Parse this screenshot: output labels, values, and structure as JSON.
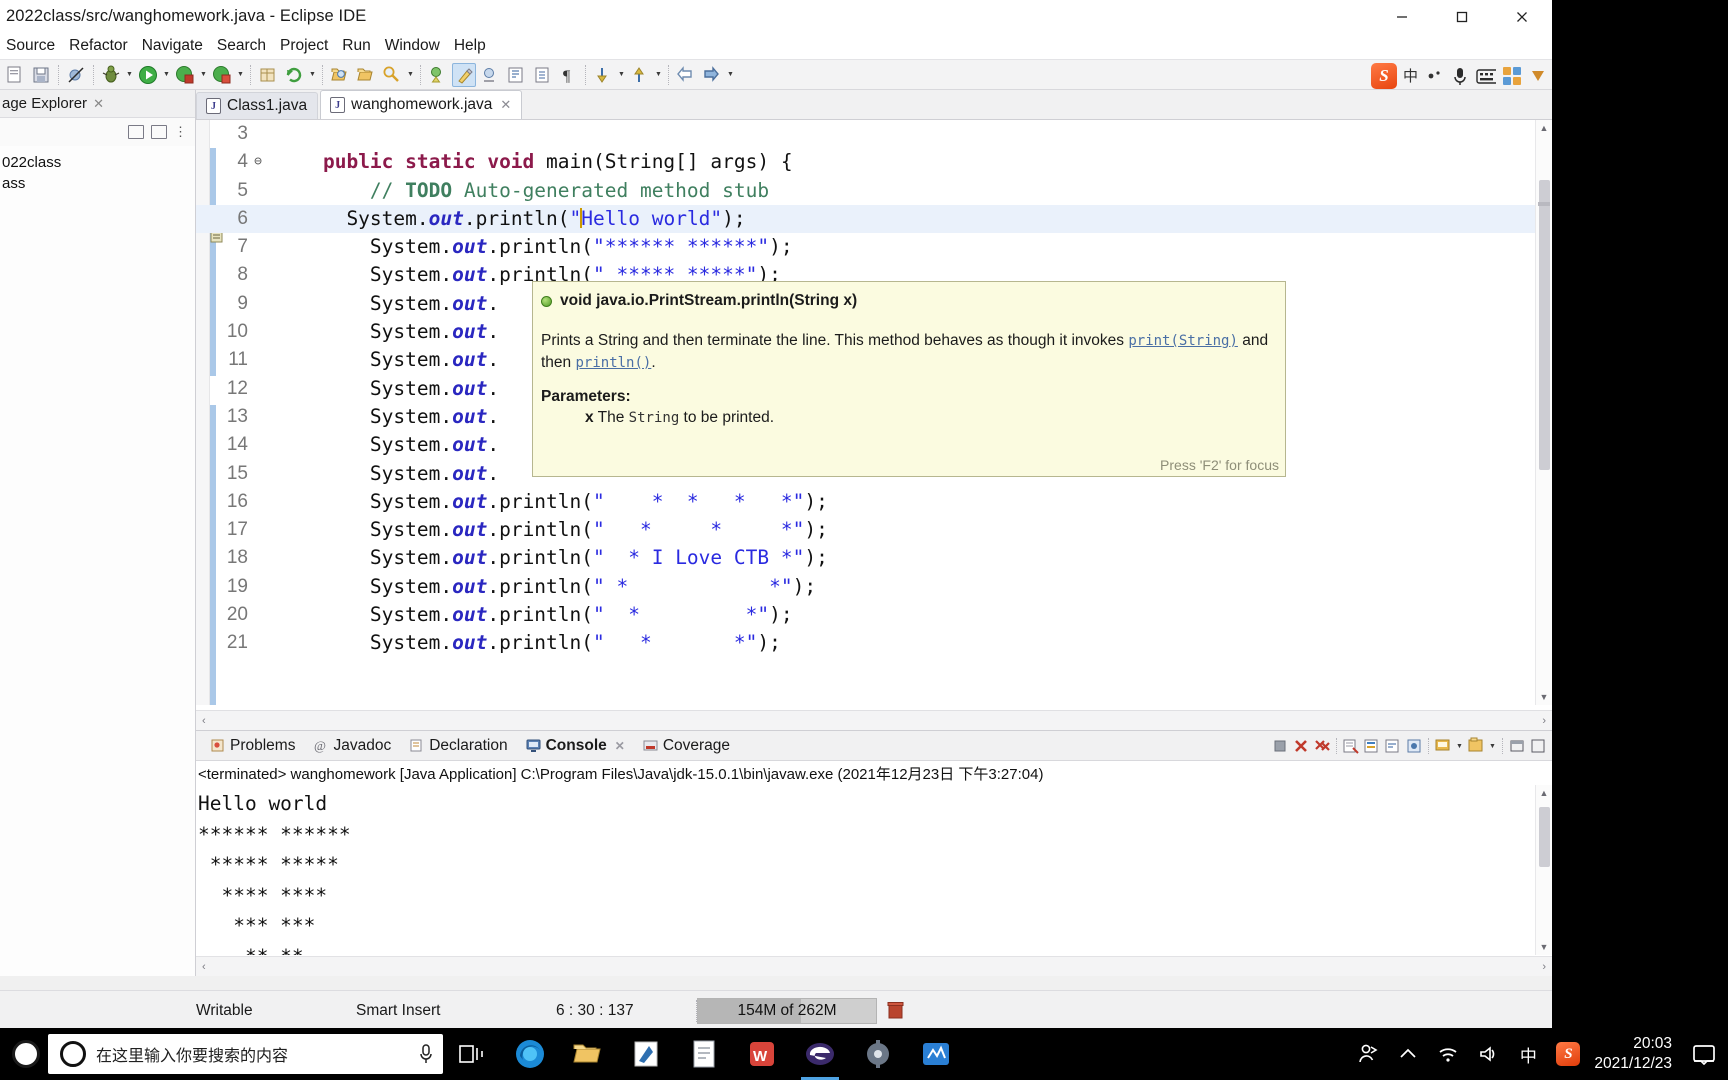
{
  "window": {
    "title": "2022class/src/wanghomework.java - Eclipse IDE",
    "minimize_label": "Minimize",
    "maximize_label": "Maximize",
    "close_label": "Close"
  },
  "menubar": {
    "items": [
      {
        "label": "Source"
      },
      {
        "label": "Refactor"
      },
      {
        "label": "Navigate"
      },
      {
        "label": "Search"
      },
      {
        "label": "Project"
      },
      {
        "label": "Run"
      },
      {
        "label": "Window"
      },
      {
        "label": "Help"
      }
    ]
  },
  "toolbar": {
    "ime_lang": "中",
    "sogou_label": "S"
  },
  "explorer": {
    "tab_label": "age Explorer",
    "tree": [
      {
        "label": "022class"
      },
      {
        "label": "ass"
      }
    ]
  },
  "editor": {
    "tabs": [
      {
        "label": "Class1.java",
        "active": false,
        "closable": false
      },
      {
        "label": "wanghomework.java",
        "active": true,
        "closable": true
      }
    ],
    "lines": [
      {
        "num": "3",
        "fold": "",
        "current": false,
        "tokens": []
      },
      {
        "num": "4",
        "fold": "⊖",
        "current": false,
        "tokens": [
          {
            "t": "    ",
            "c": "pln"
          },
          {
            "t": "public static void ",
            "c": "kw"
          },
          {
            "t": "main(String[] args) {",
            "c": "pln"
          }
        ]
      },
      {
        "num": "5",
        "fold": "",
        "current": false,
        "tokens": [
          {
            "t": "        ",
            "c": "pln"
          },
          {
            "t": "// ",
            "c": "cmt"
          },
          {
            "t": "TODO",
            "c": "cmtb"
          },
          {
            "t": " Auto-generated method stub",
            "c": "cmt"
          }
        ]
      },
      {
        "num": "6",
        "fold": "",
        "current": true,
        "tokens": [
          {
            "t": "      System.",
            "c": "pln"
          },
          {
            "t": "out",
            "c": "fld"
          },
          {
            "t": ".println(",
            "c": "pln"
          },
          {
            "t": "\"",
            "c": "str"
          },
          {
            "t": "|CARET|",
            "c": "caret"
          },
          {
            "t": "Hello world\"",
            "c": "str"
          },
          {
            "t": ");",
            "c": "pln"
          }
        ]
      },
      {
        "num": "7",
        "fold": "",
        "current": false,
        "tokens": [
          {
            "t": "        System.",
            "c": "pln"
          },
          {
            "t": "out",
            "c": "fld"
          },
          {
            "t": ".println(",
            "c": "pln"
          },
          {
            "t": "\"****** ******\"",
            "c": "str"
          },
          {
            "t": ");",
            "c": "pln"
          }
        ]
      },
      {
        "num": "8",
        "fold": "",
        "current": false,
        "tokens": [
          {
            "t": "        System.",
            "c": "pln"
          },
          {
            "t": "out",
            "c": "fld"
          },
          {
            "t": ".println(",
            "c": "pln"
          },
          {
            "t": "\" ***** *****\"",
            "c": "str"
          },
          {
            "t": ");",
            "c": "pln"
          }
        ]
      },
      {
        "num": "9",
        "fold": "",
        "current": false,
        "tokens": [
          {
            "t": "        System.",
            "c": "pln"
          },
          {
            "t": "out",
            "c": "fld"
          },
          {
            "t": ".",
            "c": "pln"
          }
        ]
      },
      {
        "num": "10",
        "fold": "",
        "current": false,
        "tokens": [
          {
            "t": "        System.",
            "c": "pln"
          },
          {
            "t": "out",
            "c": "fld"
          },
          {
            "t": ".",
            "c": "pln"
          }
        ]
      },
      {
        "num": "11",
        "fold": "",
        "current": false,
        "tokens": [
          {
            "t": "        System.",
            "c": "pln"
          },
          {
            "t": "out",
            "c": "fld"
          },
          {
            "t": ".",
            "c": "pln"
          }
        ]
      },
      {
        "num": "12",
        "fold": "",
        "current": false,
        "tokens": [
          {
            "t": "        System.",
            "c": "pln"
          },
          {
            "t": "out",
            "c": "fld"
          },
          {
            "t": ".",
            "c": "pln"
          }
        ]
      },
      {
        "num": "13",
        "fold": "",
        "current": false,
        "tokens": [
          {
            "t": "        System.",
            "c": "pln"
          },
          {
            "t": "out",
            "c": "fld"
          },
          {
            "t": ".",
            "c": "pln"
          }
        ]
      },
      {
        "num": "14",
        "fold": "",
        "current": false,
        "tokens": [
          {
            "t": "        System.",
            "c": "pln"
          },
          {
            "t": "out",
            "c": "fld"
          },
          {
            "t": ".",
            "c": "pln"
          }
        ]
      },
      {
        "num": "15",
        "fold": "",
        "current": false,
        "tokens": [
          {
            "t": "        System.",
            "c": "pln"
          },
          {
            "t": "out",
            "c": "fld"
          },
          {
            "t": ".",
            "c": "pln"
          }
        ]
      },
      {
        "num": "16",
        "fold": "",
        "current": false,
        "tokens": [
          {
            "t": "        System.",
            "c": "pln"
          },
          {
            "t": "out",
            "c": "fld"
          },
          {
            "t": ".println(",
            "c": "pln"
          },
          {
            "t": "\"    *  *   *   *\"",
            "c": "str"
          },
          {
            "t": ");",
            "c": "pln"
          }
        ]
      },
      {
        "num": "17",
        "fold": "",
        "current": false,
        "tokens": [
          {
            "t": "        System.",
            "c": "pln"
          },
          {
            "t": "out",
            "c": "fld"
          },
          {
            "t": ".println(",
            "c": "pln"
          },
          {
            "t": "\"   *     *     *\"",
            "c": "str"
          },
          {
            "t": ");",
            "c": "pln"
          }
        ]
      },
      {
        "num": "18",
        "fold": "",
        "current": false,
        "tokens": [
          {
            "t": "        System.",
            "c": "pln"
          },
          {
            "t": "out",
            "c": "fld"
          },
          {
            "t": ".println(",
            "c": "pln"
          },
          {
            "t": "\"  * I Love CTB *\"",
            "c": "str"
          },
          {
            "t": ");",
            "c": "pln"
          }
        ]
      },
      {
        "num": "19",
        "fold": "",
        "current": false,
        "tokens": [
          {
            "t": "        System.",
            "c": "pln"
          },
          {
            "t": "out",
            "c": "fld"
          },
          {
            "t": ".println(",
            "c": "pln"
          },
          {
            "t": "\" *            *\"",
            "c": "str"
          },
          {
            "t": ");",
            "c": "pln"
          }
        ]
      },
      {
        "num": "20",
        "fold": "",
        "current": false,
        "tokens": [
          {
            "t": "        System.",
            "c": "pln"
          },
          {
            "t": "out",
            "c": "fld"
          },
          {
            "t": ".println(",
            "c": "pln"
          },
          {
            "t": "\"  *         *\"",
            "c": "str"
          },
          {
            "t": ");",
            "c": "pln"
          }
        ]
      },
      {
        "num": "21",
        "fold": "",
        "current": false,
        "tokens": [
          {
            "t": "        System.",
            "c": "pln"
          },
          {
            "t": "out",
            "c": "fld"
          },
          {
            "t": ".println(",
            "c": "pln"
          },
          {
            "t": "\"   *       *\"",
            "c": "str"
          },
          {
            "t": ");",
            "c": "pln"
          }
        ]
      }
    ]
  },
  "tooltip": {
    "signature": "void java.io.PrintStream.println(String x)",
    "body_pre": "Prints a String and then terminate the line. This method behaves as though it invokes ",
    "link1": "print(String)",
    "body_mid": " and then ",
    "link2": "println()",
    "body_post": ".",
    "params_label": "Parameters:",
    "param_name": "x",
    "param_desc_pre": "The ",
    "param_type": "String",
    "param_desc_post": " to be printed.",
    "focus_hint": "Press 'F2' for focus"
  },
  "console": {
    "tabs": [
      {
        "label": "Problems",
        "active": false,
        "closable": false
      },
      {
        "label": "Javadoc",
        "active": false,
        "closable": false
      },
      {
        "label": "Declaration",
        "active": false,
        "closable": false
      },
      {
        "label": "Console",
        "active": true,
        "closable": true
      },
      {
        "label": "Coverage",
        "active": false,
        "closable": false
      }
    ],
    "status_line": "<terminated> wanghomework [Java Application] C:\\Program Files\\Java\\jdk-15.0.1\\bin\\javaw.exe (2021年12月23日 下午3:27:04)",
    "output": "Hello world\n****** ******\n ***** *****\n  **** ****\n   *** ***\n    ** **\n     * *"
  },
  "statusbar": {
    "writable": "Writable",
    "insert_mode": "Smart Insert",
    "position": "6 : 30 : 137",
    "heap": "154M of 262M",
    "heap_percent": 58
  },
  "taskbar": {
    "search_placeholder": "在这里输入你要搜索的内容",
    "ime_lang": "中",
    "sogou_label": "S",
    "time": "20:03",
    "date": "2021/12/23"
  }
}
